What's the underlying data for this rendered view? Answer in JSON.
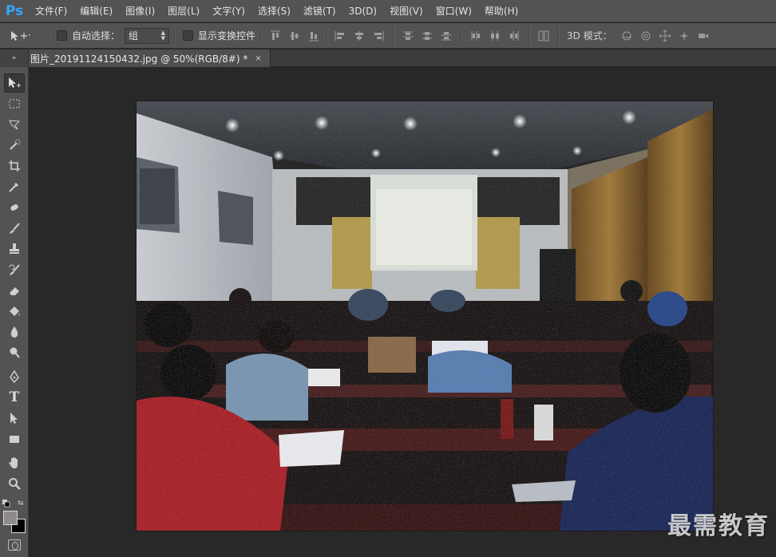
{
  "app": {
    "logo": "Ps",
    "colors": {
      "accent": "#31a8ff",
      "chrome": "#535353",
      "workspace": "#282828"
    }
  },
  "menu": [
    {
      "label": "文件(F)"
    },
    {
      "label": "编辑(E)"
    },
    {
      "label": "图像(I)"
    },
    {
      "label": "图层(L)"
    },
    {
      "label": "文字(Y)"
    },
    {
      "label": "选择(S)"
    },
    {
      "label": "滤镜(T)"
    },
    {
      "label": "3D(D)"
    },
    {
      "label": "视图(V)"
    },
    {
      "label": "窗口(W)"
    },
    {
      "label": "帮助(H)"
    }
  ],
  "options": {
    "auto_select_label": "自动选择：",
    "auto_select_value": "组",
    "show_transform_label": "显示变换控件",
    "mode3d_label": "3D 模式："
  },
  "document": {
    "tab_title": "图片_20191124150432.jpg @ 50%(RGB/8#) *",
    "close_glyph": "×"
  },
  "collapse_glyph": "»",
  "colors": {
    "foreground": "#8f8a8c",
    "background": "#000000"
  },
  "tools": [
    {
      "name": "move-tool-icon",
      "active": true
    },
    {
      "name": "marquee-tool-icon"
    },
    {
      "name": "lasso-tool-icon"
    },
    {
      "name": "quick-selection-tool-icon"
    },
    {
      "name": "crop-tool-icon"
    },
    {
      "name": "eyedropper-tool-icon"
    },
    {
      "name": "healing-brush-tool-icon"
    },
    {
      "name": "brush-tool-icon"
    },
    {
      "name": "clone-stamp-tool-icon"
    },
    {
      "name": "history-brush-tool-icon"
    },
    {
      "name": "eraser-tool-icon"
    },
    {
      "name": "paint-bucket-tool-icon"
    },
    {
      "name": "blur-tool-icon"
    },
    {
      "name": "dodge-tool-icon"
    },
    {
      "name": "pen-tool-icon"
    },
    {
      "name": "type-tool-icon",
      "glyph": "T"
    },
    {
      "name": "path-selection-tool-icon"
    },
    {
      "name": "rectangle-tool-icon"
    },
    {
      "name": "hand-tool-icon"
    },
    {
      "name": "zoom-tool-icon"
    }
  ],
  "watermark": "最需教育"
}
